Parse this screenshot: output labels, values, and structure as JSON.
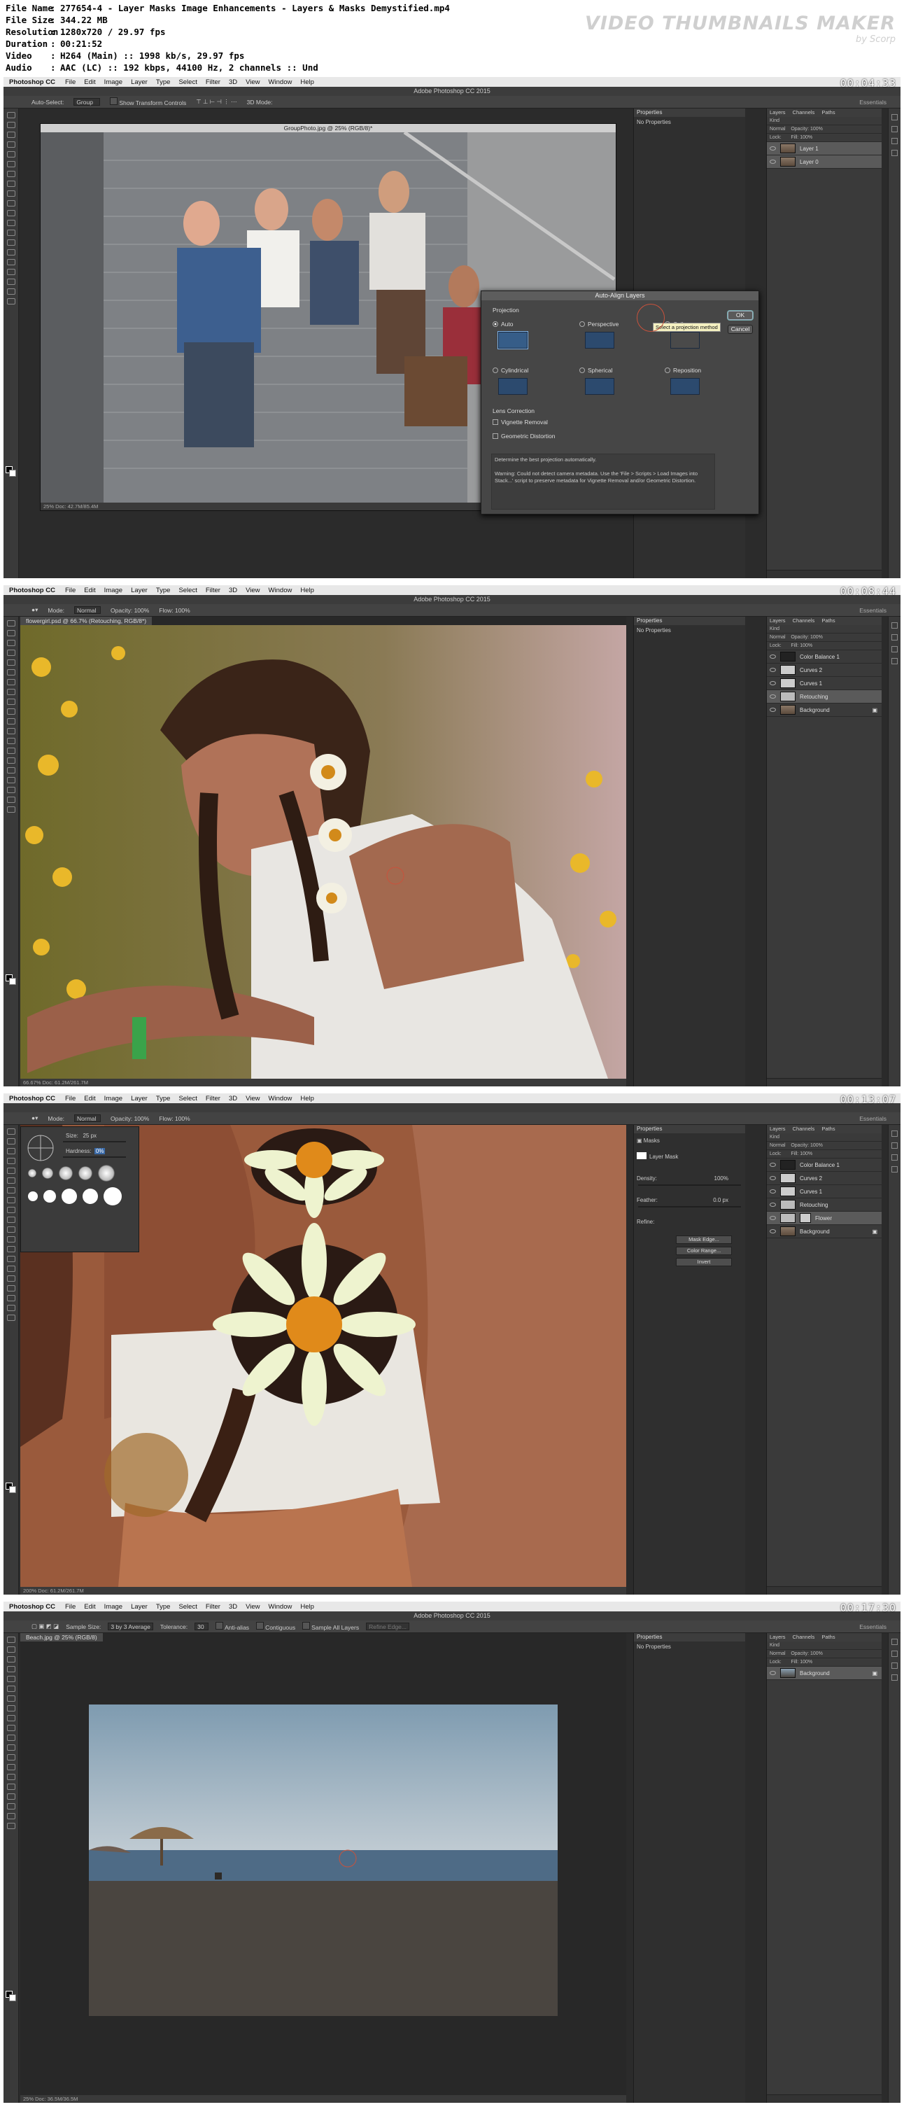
{
  "header": {
    "info": [
      {
        "key": "File Name",
        "value": "277654-4 - Layer Masks Image Enhancements - Layers & Masks Demystified.mp4"
      },
      {
        "key": "File Size",
        "value": "344.22 MB"
      },
      {
        "key": "Resolution",
        "value": "1280x720 / 29.97 fps"
      },
      {
        "key": "Duration",
        "value": "00:21:52"
      },
      {
        "key": "Video",
        "value": "H264 (Main) :: 1998 kb/s, 29.97 fps"
      },
      {
        "key": "Audio",
        "value": "AAC (LC) :: 192 kbps, 44100 Hz, 2 channels :: Und"
      }
    ],
    "brand_main": "VIDEO THUMBNAILS MAKER",
    "brand_sub": "by Scorp"
  },
  "frames": [
    {
      "timestamp": "00:04:33",
      "menu": {
        "app": "Photoshop CC",
        "items": [
          "File",
          "Edit",
          "Image",
          "Layer",
          "Type",
          "Select",
          "Filter",
          "3D",
          "View",
          "Window",
          "Help"
        ]
      },
      "window_title": "Adobe Photoshop CC 2015",
      "options": [
        "Auto-Select:",
        "Group",
        "Show Transform Controls",
        "3D Mode:"
      ],
      "workspace": "Essentials",
      "doc_tab": "GroupPhoto.jpg @ 25% (RGB/8)*",
      "status": "25%     Doc: 42.7M/85.4M",
      "properties_title": "Properties",
      "properties_text": "No Properties",
      "layers_tabs": [
        "Layers",
        "Channels",
        "Paths"
      ],
      "layers_ctrl": [
        "Kind",
        "Normal",
        "Opacity: 100%",
        "Lock:",
        "Fill: 100%"
      ],
      "layers": [
        {
          "name": "Layer 1",
          "selected": true
        },
        {
          "name": "Layer 0",
          "selected": true
        }
      ],
      "dialog": {
        "title": "Auto-Align Layers",
        "section": "Projection",
        "options": [
          "Auto",
          "Perspective",
          "Collage",
          "Cylindrical",
          "Spherical",
          "Reposition"
        ],
        "lens": "Lens Correction",
        "vignette": "Vignette Removal",
        "geometric": "Geometric Distortion",
        "ok": "OK",
        "cancel": "Cancel",
        "tooltip": "Select a projection method",
        "desc_line1": "Determine the best projection automatically.",
        "desc_line2": "Warning: Could not detect camera metadata. Use the 'File > Scripts > Load Images into Stack...' script to preserve metadata for Vignette Removal and/or Geometric Distortion."
      }
    },
    {
      "timestamp": "00:08:44",
      "menu": {
        "app": "Photoshop CC",
        "items": [
          "File",
          "Edit",
          "Image",
          "Layer",
          "Type",
          "Select",
          "Filter",
          "3D",
          "View",
          "Window",
          "Help"
        ]
      },
      "window_title": "Adobe Photoshop CC 2015",
      "options": [
        "Mode:",
        "Normal",
        "Opacity: 100%",
        "Flow: 100%"
      ],
      "workspace": "Essentials",
      "doc_tab": "flowergirl.psd @ 66.7% (Retouching, RGB/8*)",
      "status": "66.67%     Doc: 61.2M/261.7M",
      "properties_title": "Properties",
      "properties_text": "No Properties",
      "layers_tabs": [
        "Layers",
        "Channels",
        "Paths"
      ],
      "layers_ctrl": [
        "Kind",
        "Normal",
        "Opacity: 100%",
        "Lock:",
        "Fill: 100%"
      ],
      "layers": [
        {
          "name": "Color Balance 1",
          "selected": false
        },
        {
          "name": "Curves 2",
          "selected": false
        },
        {
          "name": "Curves 1",
          "selected": false
        },
        {
          "name": "Retouching",
          "selected": true
        },
        {
          "name": "Background",
          "selected": false
        }
      ]
    },
    {
      "timestamp": "00:13:07",
      "menu": {
        "app": "Photoshop CC",
        "items": [
          "File",
          "Edit",
          "Image",
          "Layer",
          "Type",
          "Select",
          "Filter",
          "3D",
          "View",
          "Window",
          "Help"
        ]
      },
      "window_title": "",
      "options": [
        "Mode:",
        "Normal",
        "Opacity: 100%",
        "Flow: 100%"
      ],
      "workspace": "Essentials",
      "status": "200%     Doc: 61.2M/261.7M",
      "brush": {
        "size_label": "Size:",
        "size_value": "25 px",
        "hardness_label": "Hardness:",
        "hardness_value": "0%"
      },
      "properties_title": "Properties",
      "masks": {
        "title": "Masks",
        "layer_mask": "Layer Mask",
        "density": "Density:",
        "density_value": "100%",
        "feather": "Feather:",
        "feather_value": "0.0 px",
        "refine": "Refine:",
        "mask_edge": "Mask Edge...",
        "color_range": "Color Range...",
        "invert": "Invert"
      },
      "layers_tabs": [
        "Layers",
        "Channels",
        "Paths"
      ],
      "layers_ctrl": [
        "Kind",
        "Normal",
        "Opacity: 100%",
        "Lock:",
        "Fill: 100%"
      ],
      "layers": [
        {
          "name": "Color Balance 1",
          "selected": false
        },
        {
          "name": "Curves 2",
          "selected": false
        },
        {
          "name": "Curves 1",
          "selected": false
        },
        {
          "name": "Retouching",
          "selected": false
        },
        {
          "name": "Flower",
          "selected": true
        },
        {
          "name": "Background",
          "selected": false
        }
      ]
    },
    {
      "timestamp": "00:17:30",
      "menu": {
        "app": "Photoshop CC",
        "items": [
          "File",
          "Edit",
          "Image",
          "Layer",
          "Type",
          "Select",
          "Filter",
          "3D",
          "View",
          "Window",
          "Help"
        ]
      },
      "window_title": "Adobe Photoshop CC 2015",
      "options": [
        "Sample Size:",
        "3 by 3 Average",
        "Tolerance:",
        "30",
        "Anti-alias",
        "Contiguous",
        "Sample All Layers",
        "Refine Edge..."
      ],
      "workspace": "Essentials",
      "doc_tab": "Beach.jpg @ 25% (RGB/8)",
      "status": "25%     Doc: 36.5M/36.5M",
      "properties_title": "Properties",
      "properties_text": "No Properties",
      "layers_tabs": [
        "Layers",
        "Channels",
        "Paths"
      ],
      "layers_ctrl": [
        "Kind",
        "Normal",
        "Opacity: 100%",
        "Lock:",
        "Fill: 100%"
      ],
      "layers": [
        {
          "name": "Background",
          "selected": true
        }
      ]
    }
  ]
}
